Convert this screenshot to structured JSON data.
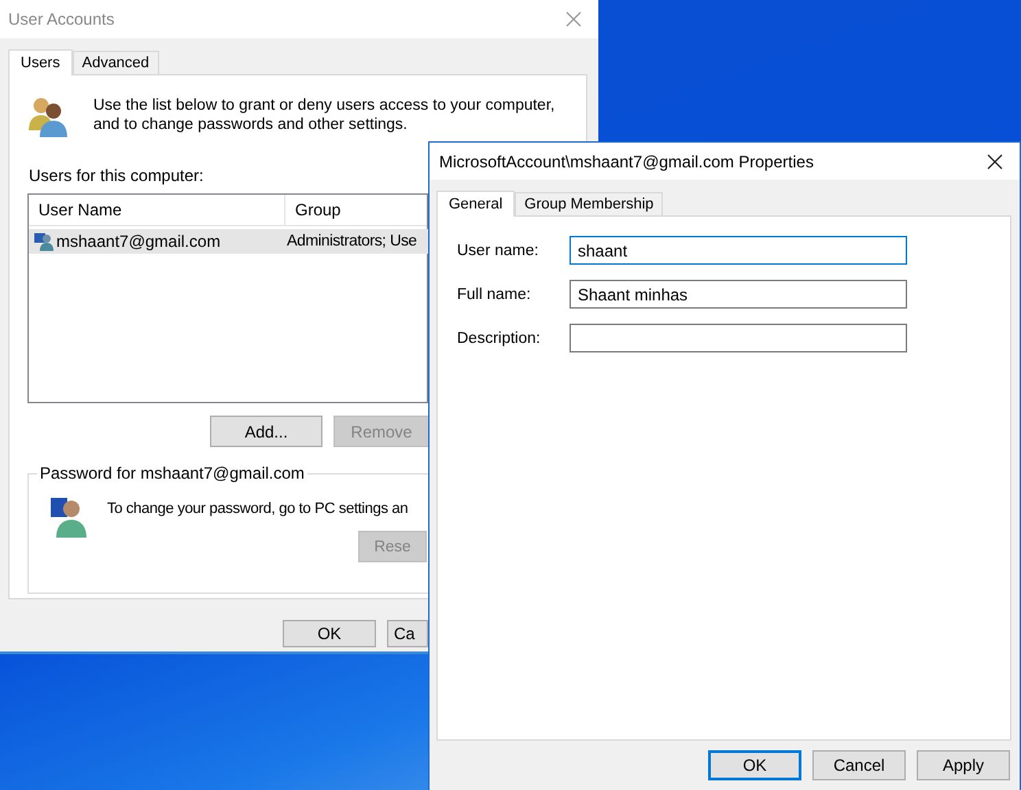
{
  "user_accounts_window": {
    "title": "User Accounts",
    "tabs": [
      {
        "label": "Users",
        "selected": true
      },
      {
        "label": "Advanced",
        "selected": false
      }
    ],
    "intro": "Use the list below to grant or deny users access to your computer,\nand to change passwords and other settings.",
    "users_label": "Users for this computer:",
    "users_table": {
      "columns": [
        "User Name",
        "Group"
      ],
      "rows": [
        {
          "cells": [
            "mshaant7@gmail.com",
            "Administrators; Use"
          ],
          "selected": true
        }
      ]
    },
    "list_buttons": [
      {
        "label": "Add...",
        "disabled": false
      },
      {
        "label": "Remove",
        "disabled": true
      }
    ],
    "password_group": {
      "title": "Password for mshaant7@gmail.com",
      "text": "To change your password, go to PC settings an",
      "button": {
        "label": "Rese",
        "disabled": true
      }
    },
    "footer_buttons": [
      {
        "label": "OK",
        "disabled": false
      },
      {
        "label": "Ca",
        "disabled": false
      }
    ]
  },
  "properties_window": {
    "title": "MicrosoftAccount\\mshaant7@gmail.com Properties",
    "tabs": [
      {
        "label": "General",
        "selected": true
      },
      {
        "label": "Group Membership",
        "selected": false
      }
    ],
    "fields": [
      {
        "label": "User name:",
        "value": "shaant",
        "focused": true
      },
      {
        "label": "Full name:",
        "value": "Shaant minhas",
        "focused": false
      },
      {
        "label": "Description:",
        "focused": false
      }
    ],
    "buttons": [
      {
        "label": "OK",
        "default": true
      },
      {
        "label": "Cancel",
        "default": false
      },
      {
        "label": "Apply",
        "default": false
      }
    ]
  }
}
